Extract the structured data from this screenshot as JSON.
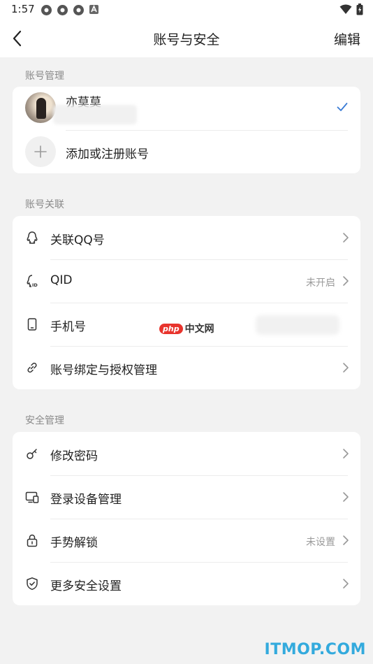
{
  "status_bar": {
    "time": "1:57"
  },
  "nav": {
    "title": "账号与安全",
    "edit_label": "编辑"
  },
  "account_management": {
    "label": "账号管理",
    "current_account_name": "亦莫莫",
    "add_account_label": "添加或注册账号"
  },
  "account_link": {
    "label": "账号关联",
    "items": [
      {
        "label": "关联QQ号",
        "value": "",
        "icon": "qq-icon"
      },
      {
        "label": "QID",
        "value": "未开启",
        "icon": "qid-icon"
      },
      {
        "label": "手机号",
        "value": "",
        "icon": "phone-icon"
      },
      {
        "label": "账号绑定与授权管理",
        "value": "",
        "icon": "link-icon"
      }
    ]
  },
  "security": {
    "label": "安全管理",
    "items": [
      {
        "label": "修改密码",
        "value": "",
        "icon": "key-icon"
      },
      {
        "label": "登录设备管理",
        "value": "",
        "icon": "devices-icon"
      },
      {
        "label": "手势解锁",
        "value": "未设置",
        "icon": "lock-icon"
      },
      {
        "label": "更多安全设置",
        "value": "",
        "icon": "shield-icon"
      }
    ]
  },
  "watermarks": {
    "php_badge": "php",
    "php_text": "中文网",
    "site": "ITMOP.COM"
  },
  "colors": {
    "accent_check": "#3a7bd5",
    "background": "#f2f2f2",
    "card": "#ffffff"
  }
}
